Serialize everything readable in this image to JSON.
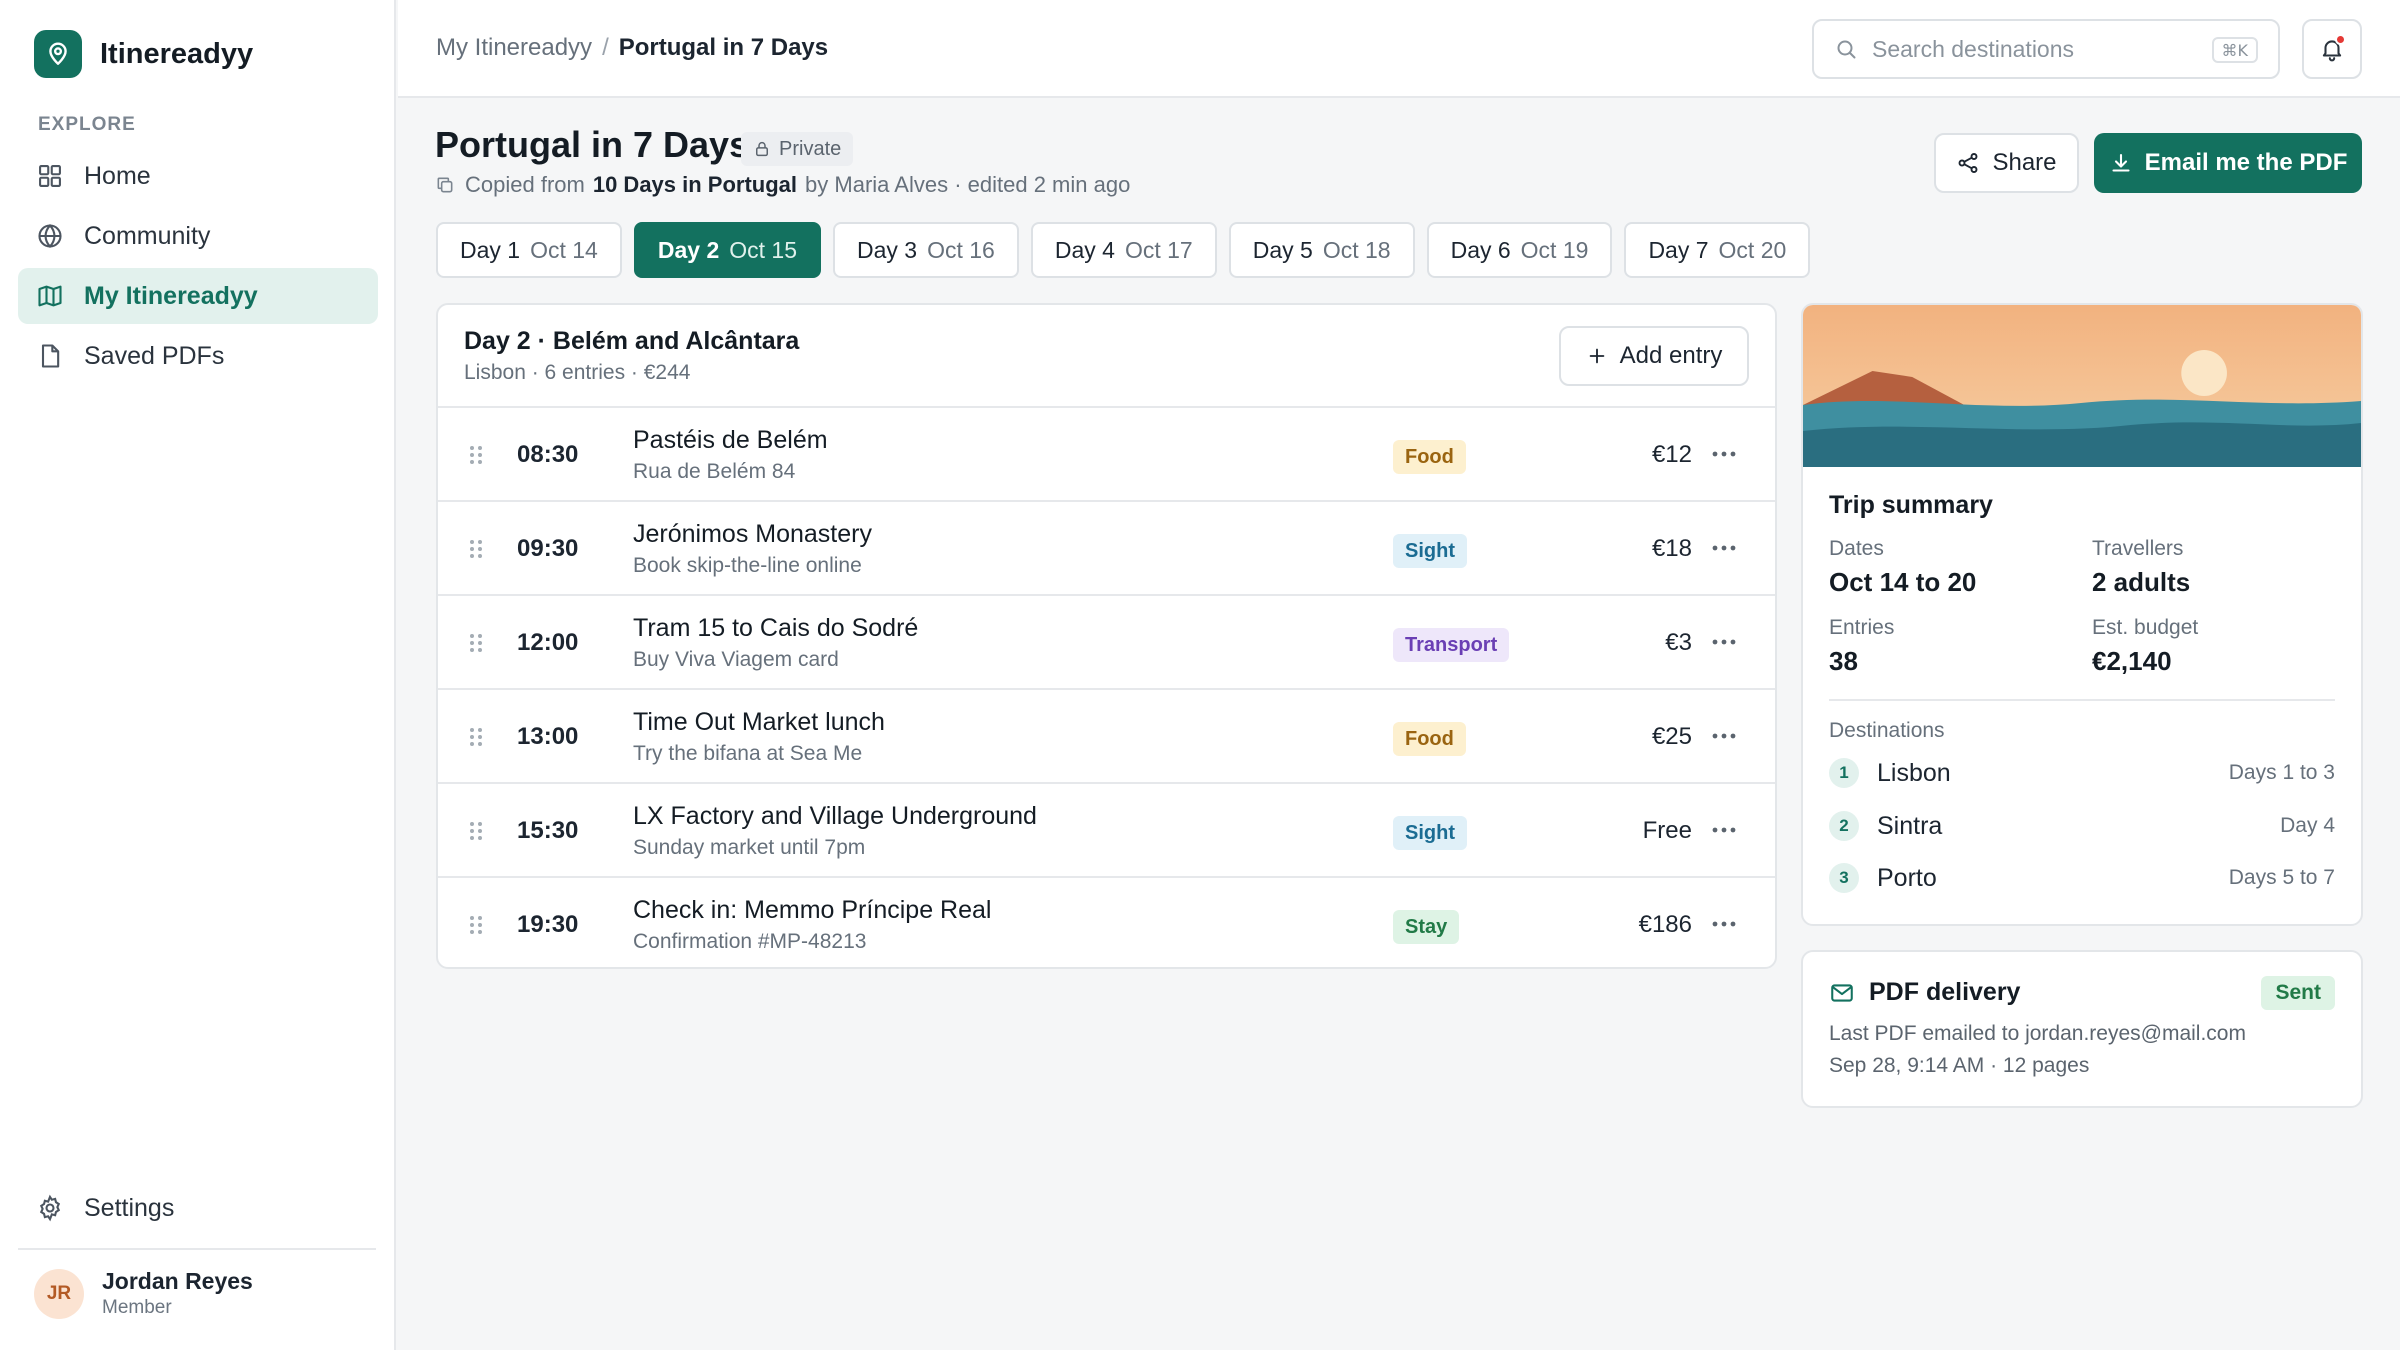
{
  "app": {
    "name": "Itinereadyy"
  },
  "sidebar": {
    "section_label": "EXPLORE",
    "items": [
      {
        "label": "Home",
        "icon": "grid-icon"
      },
      {
        "label": "Community",
        "icon": "globe-icon"
      },
      {
        "label": "My Itinereadyy",
        "icon": "map-icon",
        "active": true
      },
      {
        "label": "Saved PDFs",
        "icon": "file-icon"
      }
    ],
    "settings_label": "Settings",
    "user": {
      "initials": "JR",
      "name": "Jordan Reyes",
      "role": "Member"
    }
  },
  "topbar": {
    "breadcrumb": {
      "parent": "My Itinereadyy",
      "separator": "/",
      "current": "Portugal in 7 Days"
    },
    "search": {
      "placeholder": "Search destinations",
      "shortcut": "⌘K"
    },
    "has_notification": true
  },
  "trip": {
    "title": "Portugal in 7 Days",
    "visibility": "Private",
    "copied_prefix": "Copied from",
    "copied_source": "10 Days in Portugal",
    "copied_suffix": "by Maria Alves · edited 2 min ago",
    "share_label": "Share",
    "email_label": "Email me the PDF"
  },
  "days": [
    {
      "day": "Day 1",
      "date": "Oct 14"
    },
    {
      "day": "Day 2",
      "date": "Oct 15",
      "active": true
    },
    {
      "day": "Day 3",
      "date": "Oct 16"
    },
    {
      "day": "Day 4",
      "date": "Oct 17"
    },
    {
      "day": "Day 5",
      "date": "Oct 18"
    },
    {
      "day": "Day 6",
      "date": "Oct 19"
    },
    {
      "day": "Day 7",
      "date": "Oct 20"
    }
  ],
  "day_detail": {
    "title": "Day 2 · Belém and Alcântara",
    "subtitle": "Lisbon · 6 entries · €244",
    "add_label": "Add entry",
    "entries": [
      {
        "time": "08:30",
        "title": "Pastéis de Belém",
        "note": "Rua de Belém 84",
        "tag": "Food",
        "tag_type": "food",
        "price": "€12"
      },
      {
        "time": "09:30",
        "title": "Jerónimos Monastery",
        "note": "Book skip-the-line online",
        "tag": "Sight",
        "tag_type": "sight",
        "price": "€18"
      },
      {
        "time": "12:00",
        "title": "Tram 15 to Cais do Sodré",
        "note": "Buy Viva Viagem card",
        "tag": "Transport",
        "tag_type": "transport",
        "price": "€3"
      },
      {
        "time": "13:00",
        "title": "Time Out Market lunch",
        "note": "Try the bifana at Sea Me",
        "tag": "Food",
        "tag_type": "food",
        "price": "€25"
      },
      {
        "time": "15:30",
        "title": "LX Factory and Village Underground",
        "note": "Sunday market until 7pm",
        "tag": "Sight",
        "tag_type": "sight",
        "price": "Free"
      },
      {
        "time": "19:30",
        "title": "Check in: Memmo Príncipe Real",
        "note": "Confirmation #MP-48213",
        "tag": "Stay",
        "tag_type": "stay",
        "price": "€186"
      }
    ]
  },
  "summary": {
    "title": "Trip summary",
    "stats": [
      {
        "label": "Dates",
        "value": "Oct 14 to 20"
      },
      {
        "label": "Travellers",
        "value": "2 adults"
      },
      {
        "label": "Entries",
        "value": "38"
      },
      {
        "label": "Est. budget",
        "value": "€2,140"
      }
    ],
    "destinations_label": "Destinations",
    "destinations": [
      {
        "num": "1",
        "name": "Lisbon",
        "days": "Days 1 to 3"
      },
      {
        "num": "2",
        "name": "Sintra",
        "days": "Day 4"
      },
      {
        "num": "3",
        "name": "Porto",
        "days": "Days 5 to 7"
      }
    ]
  },
  "pdf": {
    "title": "PDF delivery",
    "status": "Sent",
    "line1": "Last PDF emailed to jordan.reyes@mail.com",
    "line2": "Sep 28, 9:14 AM · 12 pages"
  },
  "colors": {
    "accent": "#13715f",
    "accent_light": "#e2f1ed",
    "food": "#9a6410",
    "sight": "#1b6c93",
    "transport": "#6a3fb4",
    "stay": "#217a47",
    "notification": "#e53935"
  }
}
